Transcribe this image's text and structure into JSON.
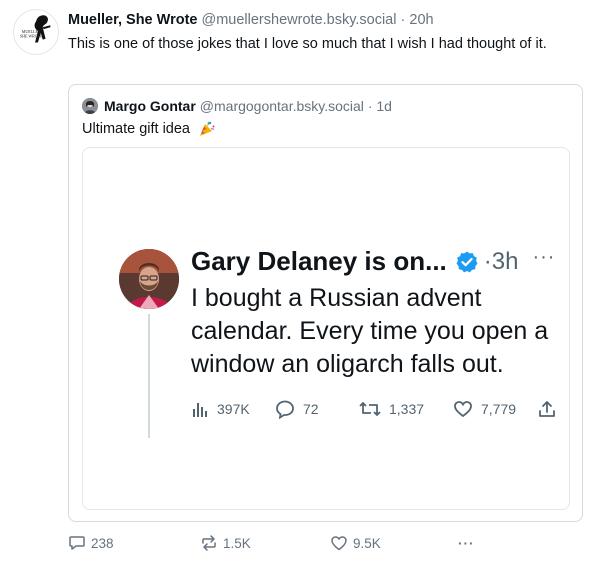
{
  "post": {
    "author_name": "Mueller, She Wrote",
    "author_handle": "@muellershewrote.bsky.social",
    "separator": "·",
    "time": "20h",
    "text": "This is one of those jokes that I love so much that I wish I had thought of it.",
    "avatar_logo_text": [
      "MUELLER",
      "SHE WROTE"
    ]
  },
  "quote": {
    "author_name": "Margo Gontar",
    "author_handle": "@margogontar.bsky.social",
    "separator": "·",
    "time": "1d",
    "text": "Ultimate gift idea",
    "emoji_icon": "party-popper-icon"
  },
  "embedded_tweet": {
    "author_name": "Gary Delaney is on...",
    "verified_icon": "verified-badge-icon",
    "separator": "·",
    "time": "3h",
    "more": "···",
    "text": "I bought a Russian advent calendar. Every time you open a window an oligarch falls out.",
    "stats": {
      "views": "397K",
      "replies": "72",
      "retweets": "1,337",
      "likes": "7,779"
    }
  },
  "actions": {
    "replies": "238",
    "reposts": "1.5K",
    "likes": "9.5K",
    "more": "···"
  },
  "colors": {
    "text": "#0f1419",
    "muted": "#66737f",
    "border": "#d4dbe2",
    "verified": "#1d9bf0"
  }
}
